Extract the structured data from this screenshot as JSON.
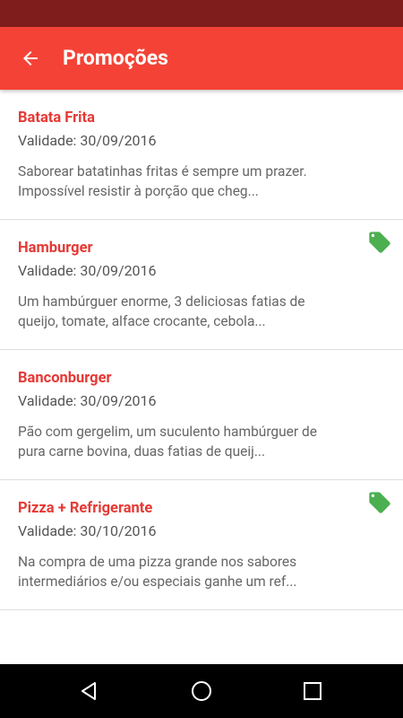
{
  "colors": {
    "status_bar": "#7f1d1d",
    "app_bar": "#f44336",
    "title_text": "#e53935",
    "tag_icon": "#4caf50",
    "nav_bar": "#000000"
  },
  "header": {
    "back_icon": "arrow-back-icon",
    "title": "Promoções"
  },
  "promotions": [
    {
      "title": "Batata Frita",
      "validity": "Validade: 30/09/2016",
      "description_lines": [
        "Saborear batatinhas fritas é sempre um prazer.",
        "Impossível resistir à porção que cheg..."
      ],
      "tagged": false
    },
    {
      "title": "Hamburger",
      "validity": "Validade: 30/09/2016",
      "description_lines": [
        "Um hambúrguer enorme, 3 deliciosas fatias de",
        "queijo, tomate, alface crocante, cebola..."
      ],
      "tagged": true
    },
    {
      "title": "Banconburger",
      "validity": "Validade: 30/09/2016",
      "description_lines": [
        "Pão com gergelim, um suculento hambúrguer de",
        "pura carne bovina, duas fatias de queij..."
      ],
      "tagged": false
    },
    {
      "title": "Pizza + Refrigerante",
      "validity": "Validade: 30/10/2016",
      "description_lines": [
        "Na compra de uma pizza grande nos sabores",
        "intermediários e/ou especiais ganhe um ref..."
      ],
      "tagged": true
    }
  ],
  "nav": {
    "back_icon": "triangle-back-icon",
    "home_icon": "circle-home-icon",
    "recents_icon": "square-recents-icon"
  }
}
